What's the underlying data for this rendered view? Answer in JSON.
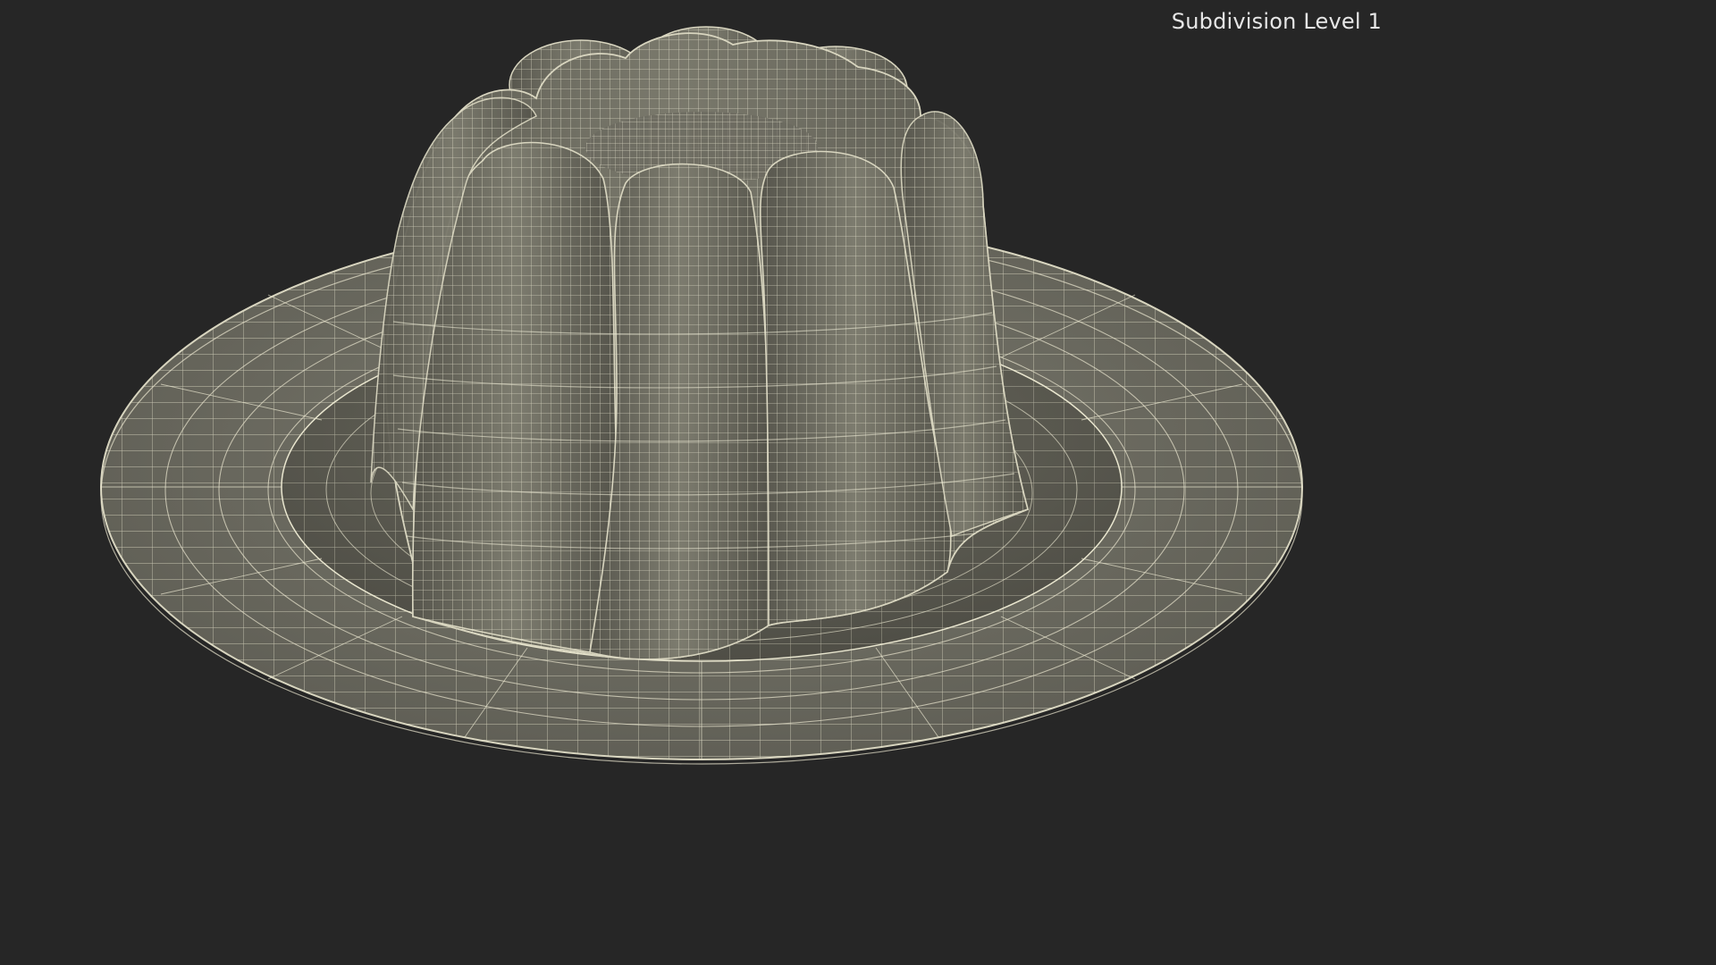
{
  "viewport": {
    "label": "Subdivision Level 1",
    "background": "#262626",
    "mesh_surface_color": "#6f6e63",
    "wire_color": "#e9e6cf",
    "subject": "jelly-dessert-on-plate-wireframe"
  }
}
